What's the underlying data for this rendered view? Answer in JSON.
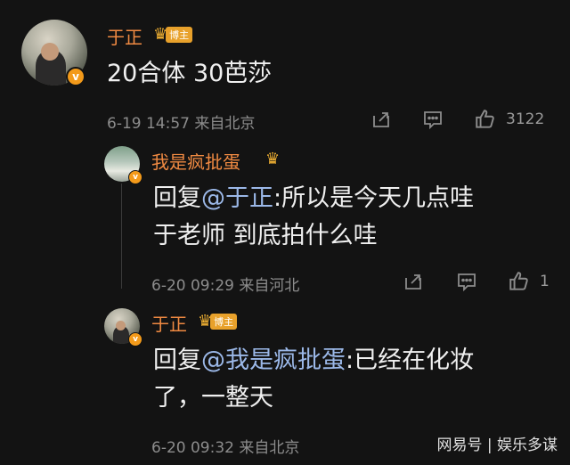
{
  "comment1": {
    "author": "于正",
    "badge": "博主",
    "text": "20合体 30芭莎",
    "date": "6-19 14:57",
    "location": "来自北京",
    "likes": "3122"
  },
  "reply1": {
    "author": "我是疯批蛋",
    "reply_prefix": "回复",
    "mention": "@于正",
    "text_line1": ":所以是今天几点哇",
    "text_line2": "于老师 到底拍什么哇",
    "date": "6-20 09:29",
    "location": "来自河北",
    "likes": "1"
  },
  "reply2": {
    "author": "于正",
    "badge": "博主",
    "reply_prefix": "回复",
    "mention": "@我是疯批蛋",
    "text_line1": ":已经在化妆",
    "text_line2": "了，一整天",
    "date": "6-20 09:32",
    "location": "来自北京"
  },
  "watermark": "网易号 | 娱乐多谋",
  "icons": [
    "share-icon",
    "comment-icon",
    "like-icon",
    "verified-icon",
    "crown-icon"
  ],
  "colors": {
    "background": "#131313",
    "username": "#f08a42",
    "mention": "#9bb8e8",
    "meta": "#8c8c8c"
  }
}
